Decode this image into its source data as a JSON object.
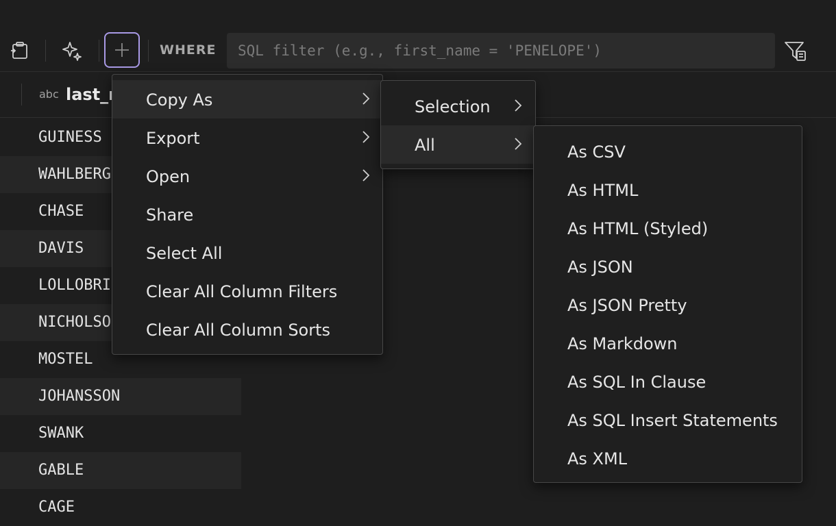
{
  "toolbar": {
    "where_label": "WHERE",
    "sql_placeholder": "SQL filter (e.g., first_name = 'PENELOPE')",
    "icons": [
      "clipboard-icon",
      "sparkles-icon",
      "plus-icon",
      "filter-icon"
    ],
    "accent_color": "#a99ae6"
  },
  "column": {
    "type_label": "abc",
    "name": "last_r"
  },
  "rows": [
    "GUINESS",
    "WAHLBERG",
    "CHASE",
    "DAVIS",
    "LOLLOBRI",
    "NICHOLSO",
    "MOSTEL",
    "JOHANSSON",
    "SWANK",
    "GABLE",
    "CAGE"
  ],
  "menu": {
    "items": [
      {
        "label": "Copy As",
        "submenu": true
      },
      {
        "label": "Export",
        "submenu": true
      },
      {
        "label": "Open",
        "submenu": true
      },
      {
        "label": "Share",
        "submenu": false
      },
      {
        "label": "Select All",
        "submenu": false
      },
      {
        "label": "Clear All Column Filters",
        "submenu": false
      },
      {
        "label": "Clear All Column Sorts",
        "submenu": false
      }
    ]
  },
  "copy_as_menu": {
    "items": [
      {
        "label": "Selection",
        "submenu": true
      },
      {
        "label": "All",
        "submenu": true
      }
    ]
  },
  "all_menu": {
    "items": [
      "As CSV",
      "As HTML",
      "As HTML (Styled)",
      "As JSON",
      "As JSON Pretty",
      "As Markdown",
      "As SQL In Clause",
      "As SQL Insert Statements",
      "As XML"
    ]
  }
}
